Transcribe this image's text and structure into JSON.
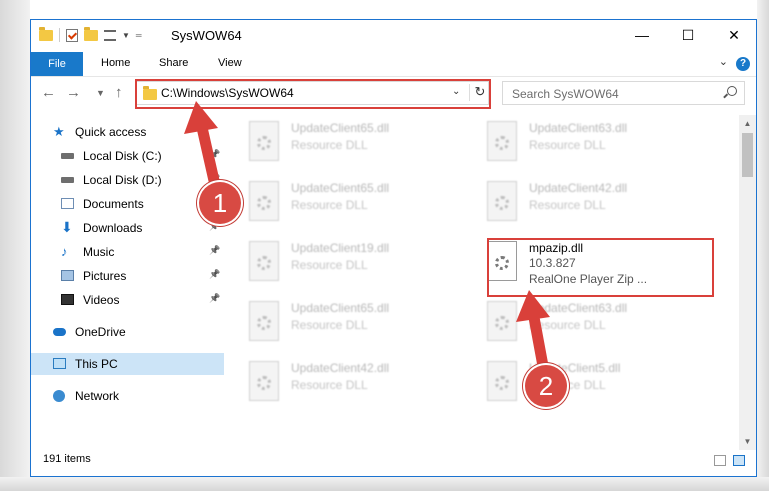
{
  "window": {
    "title": "SysWOW64"
  },
  "ribbon": {
    "tabs": [
      "File",
      "Home",
      "Share",
      "View"
    ],
    "help": "?"
  },
  "address": {
    "path": "C:\\Windows\\SysWOW64"
  },
  "search": {
    "placeholder": "Search SysWOW64"
  },
  "nav_pane": {
    "items": [
      {
        "label": "Quick access",
        "icon": "star-icon",
        "pinned": false
      },
      {
        "label": "Local Disk (C:)",
        "icon": "drive-icon",
        "pinned": true
      },
      {
        "label": "Local Disk (D:)",
        "icon": "drive-icon",
        "pinned": true
      },
      {
        "label": "Documents",
        "icon": "document-icon",
        "pinned": true
      },
      {
        "label": "Downloads",
        "icon": "download-icon",
        "pinned": true
      },
      {
        "label": "Music",
        "icon": "music-icon",
        "pinned": true
      },
      {
        "label": "Pictures",
        "icon": "pictures-icon",
        "pinned": true
      },
      {
        "label": "Videos",
        "icon": "videos-icon",
        "pinned": true
      },
      {
        "label": "OneDrive",
        "icon": "cloud-icon",
        "pinned": false
      },
      {
        "label": "This PC",
        "icon": "computer-icon",
        "pinned": false,
        "selected": true
      },
      {
        "label": "Network",
        "icon": "network-icon",
        "pinned": false
      }
    ]
  },
  "files": [
    {
      "name": "UpdateClient65.dll",
      "type": "Resource DLL"
    },
    {
      "name": "UpdateClient63.dll",
      "type": "Resource DLL"
    },
    {
      "name": "UpdateClient65.dll",
      "type": "Resource DLL"
    },
    {
      "name": "UpdateClient42.dll",
      "type": "Resource DLL"
    },
    {
      "name": "UpdateClient19.dll",
      "type": "Resource DLL"
    },
    {
      "name": "mpazip.dll",
      "version": "10.3.827",
      "description": "RealOne Player Zip ...",
      "highlighted": true
    },
    {
      "name": "UpdateClient65.dll",
      "type": "Resource DLL"
    },
    {
      "name": "UpdateClient63.dll",
      "type": "Resource DLL"
    },
    {
      "name": "UpdateClient42.dll",
      "type": "Resource DLL"
    },
    {
      "name": "UpdateClient5.dll",
      "type": "Resource DLL"
    }
  ],
  "annotations": {
    "step1": "1",
    "step2": "2",
    "color": "#d9403a"
  },
  "status": {
    "item_count": "191 items"
  }
}
